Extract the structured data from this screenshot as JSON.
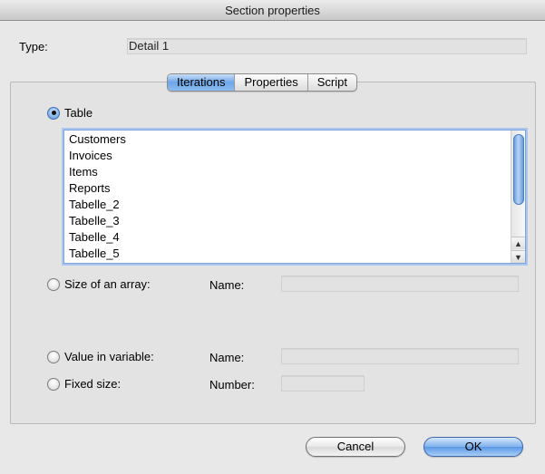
{
  "window": {
    "title": "Section properties"
  },
  "type_row": {
    "label": "Type:",
    "value": "Detail 1"
  },
  "tabs": [
    {
      "label": "Iterations",
      "active": true
    },
    {
      "label": "Properties",
      "active": false
    },
    {
      "label": "Script",
      "active": false
    }
  ],
  "iterations": {
    "table_option": {
      "label": "Table",
      "selected": true
    },
    "tables": [
      "Customers",
      "Invoices",
      "Items",
      "Reports",
      "Tabelle_2",
      "Tabelle_3",
      "Tabelle_4",
      "Tabelle_5"
    ],
    "array_option": {
      "label": "Size of an array:",
      "selected": false,
      "field_label": "Name:",
      "field_value": ""
    },
    "variable_option": {
      "label": "Value in variable:",
      "selected": false,
      "field_label": "Name:",
      "field_value": ""
    },
    "fixed_option": {
      "label": "Fixed size:",
      "selected": false,
      "field_label": "Number:",
      "field_value": ""
    }
  },
  "buttons": {
    "cancel": "Cancel",
    "ok": "OK"
  },
  "colors": {
    "accent": "#5b98e6",
    "selection_ring": "#a9c6ee"
  }
}
